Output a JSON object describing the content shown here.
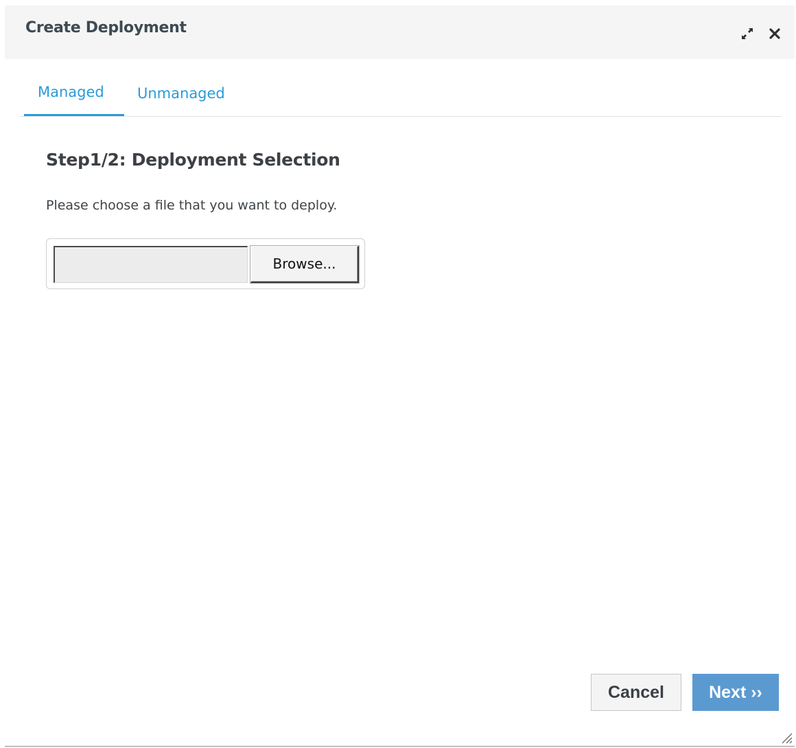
{
  "dialog": {
    "title": "Create Deployment",
    "icons": {
      "maximize": "maximize-icon",
      "close": "close-icon",
      "resize": "resize-grip-icon"
    }
  },
  "tabs": [
    {
      "label": "Managed",
      "active": true
    },
    {
      "label": "Unmanaged",
      "active": false
    }
  ],
  "step": {
    "heading": "Step1/2: Deployment Selection",
    "instruction": "Please choose a file that you want to deploy."
  },
  "file_input": {
    "value": "",
    "browse_label": "Browse..."
  },
  "footer": {
    "cancel_label": "Cancel",
    "next_label": "Next ››"
  },
  "colors": {
    "accent": "#2b9bd8",
    "primary_button": "#5b9ad1",
    "title_text": "#3d4a52",
    "titlebar_bg": "#f5f5f5"
  }
}
